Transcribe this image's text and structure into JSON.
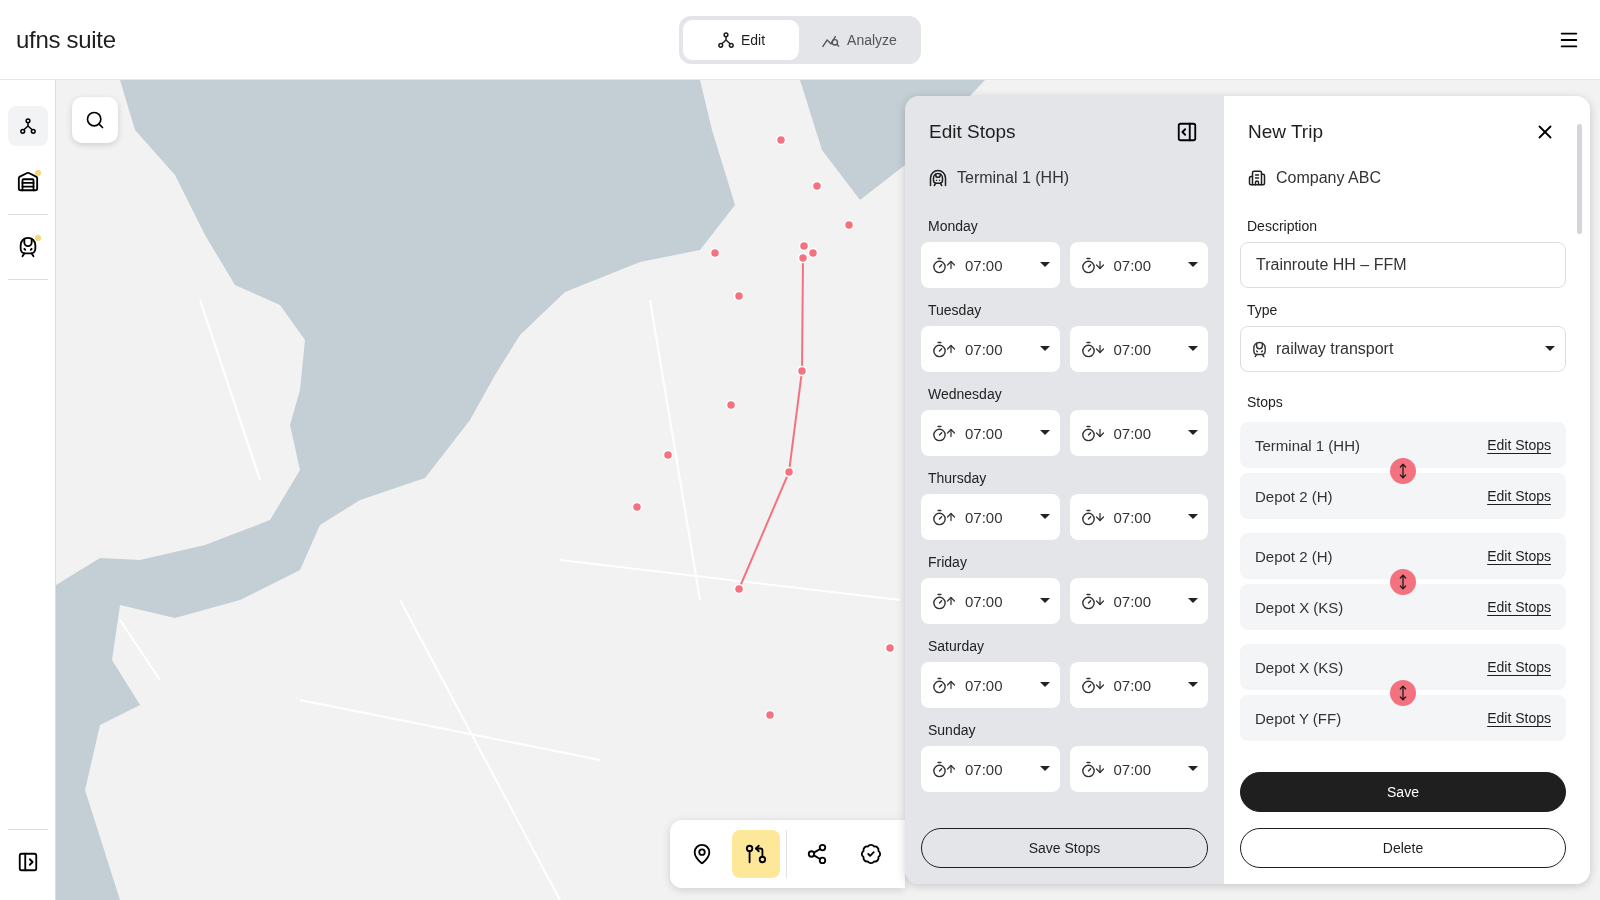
{
  "app": {
    "title": "ufns suite"
  },
  "mode_tabs": [
    {
      "label": "Edit",
      "selected": true
    },
    {
      "label": "Analyze",
      "selected": false
    }
  ],
  "sidebar": {
    "items": [
      {
        "selected": true,
        "badge": false
      },
      {
        "selected": false,
        "badge": true
      },
      {
        "selected": false,
        "badge": true
      }
    ]
  },
  "map_toolbar": {
    "tools": [
      {
        "selected": false
      },
      {
        "selected": true
      },
      {
        "selected": false
      },
      {
        "selected": false
      }
    ]
  },
  "edit_stops": {
    "title": "Edit Stops",
    "location": "Terminal 1 (HH)",
    "days": [
      {
        "name": "Monday",
        "departure": "07:00",
        "arrival": "07:00"
      },
      {
        "name": "Tuesday",
        "departure": "07:00",
        "arrival": "07:00"
      },
      {
        "name": "Wednesday",
        "departure": "07:00",
        "arrival": "07:00"
      },
      {
        "name": "Thursday",
        "departure": "07:00",
        "arrival": "07:00"
      },
      {
        "name": "Friday",
        "departure": "07:00",
        "arrival": "07:00"
      },
      {
        "name": "Saturday",
        "departure": "07:00",
        "arrival": "07:00"
      },
      {
        "name": "Sunday",
        "departure": "07:00",
        "arrival": "07:00"
      }
    ],
    "save_button": "Save Stops"
  },
  "new_trip": {
    "title": "New Trip",
    "company": "Company ABC",
    "description": {
      "label": "Description",
      "value": "Trainroute HH – FFM"
    },
    "type": {
      "label": "Type",
      "value": "railway transport"
    },
    "stops_label": "Stops",
    "legs": [
      {
        "from": {
          "name": "Terminal 1 (HH)",
          "action": "Edit Stops"
        },
        "to": {
          "name": "Depot 2 (H)",
          "action": "Edit Stops"
        }
      },
      {
        "from": {
          "name": "Depot 2 (H)",
          "action": "Edit Stops"
        },
        "to": {
          "name": "Depot X (KS)",
          "action": "Edit Stops"
        }
      },
      {
        "from": {
          "name": "Depot X (KS)",
          "action": "Edit Stops"
        },
        "to": {
          "name": "Depot Y (FF)",
          "action": "Edit Stops"
        }
      }
    ],
    "save_button": "Save",
    "delete_button": "Delete"
  }
}
